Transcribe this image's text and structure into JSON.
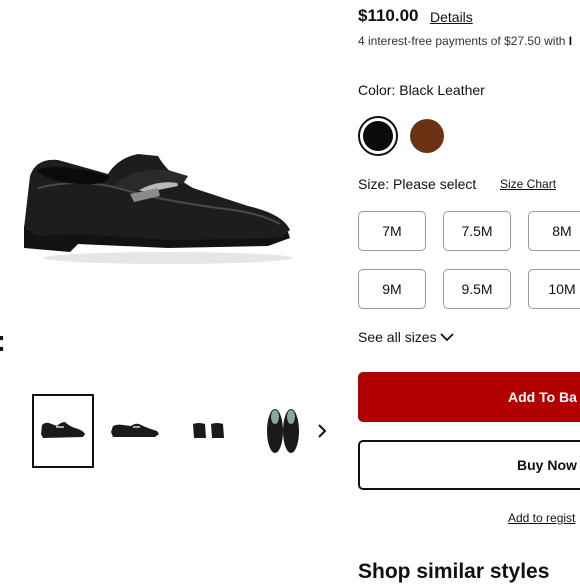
{
  "product": {
    "price": "$110.00",
    "details_link": "Details",
    "installments_text": "4 interest-free payments of $27.50 with",
    "installments_brand": "I"
  },
  "color": {
    "label": "Color: Black Leather",
    "swatches": [
      {
        "name": "Black Leather",
        "hex": "#0b0b0b",
        "selected": true
      },
      {
        "name": "Brown",
        "hex": "#6b3313",
        "selected": false
      }
    ]
  },
  "size": {
    "label": "Size: Please select",
    "chart_link": "Size Chart",
    "options": [
      "7M",
      "7.5M",
      "8M",
      "9M",
      "9.5M",
      "10M"
    ],
    "see_all": "See all sizes"
  },
  "actions": {
    "add_to_bag": "Add To Ba",
    "buy_now": "Buy Now",
    "add_to_registry": "Add to regist"
  },
  "sections": {
    "similar_title": "Shop similar styles"
  },
  "gallery": {
    "left_glyph": ":"
  },
  "colors": {
    "primary_red": "#b00000",
    "text": "#111111"
  }
}
